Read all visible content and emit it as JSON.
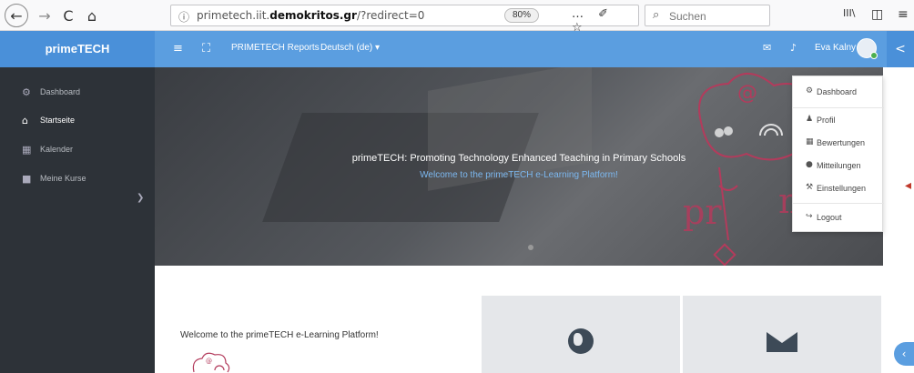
{
  "browser": {
    "back_icon": "←",
    "forward_icon": "→",
    "reload_icon": "C",
    "home_icon": "⌂",
    "url_info_icon": "ⓘ",
    "url_prefix": "primetech.iit.",
    "url_domain": "demokritos.gr",
    "url_suffix": "/?redirect=0",
    "zoom": "80%",
    "url_actions": "… ✐ ☆",
    "search_icon": "⌕",
    "search_placeholder": "Suchen",
    "library_icon": "III\\",
    "sidebar_icon": "◫",
    "menu_icon": "≡"
  },
  "header": {
    "brand": "primeTECH",
    "menu_icon": "≡",
    "fullscreen_icon": "⛶",
    "reports_link": "PRIMETECH Reports",
    "language": "Deutsch (de) ▾",
    "mail_icon": "✉",
    "bell_icon": "♪",
    "user_name": "Eva Kalny",
    "collapse_icon": "<",
    "accent_color": "#5b9ee0"
  },
  "sidebar": {
    "items": [
      {
        "icon": "⚙",
        "label": "Dashboard"
      },
      {
        "icon": "⌂",
        "label": "Startseite"
      },
      {
        "icon": "▦",
        "label": "Kalender"
      },
      {
        "icon": "■",
        "label": "Meine Kurse"
      }
    ],
    "toggle_icon": "❯"
  },
  "hero": {
    "title": "primeTECH: Promoting Technology Enhanced Teaching in Primary Schools",
    "subtitle": "Welcome to the primeTECH e-Learning Platform!"
  },
  "dropdown": {
    "items": [
      {
        "icon": "⚙",
        "label": "Dashboard"
      },
      {
        "icon": "♟",
        "label": "Profil"
      },
      {
        "icon": "▦",
        "label": "Bewertungen"
      },
      {
        "icon": "●",
        "label": "Mitteilungen"
      },
      {
        "icon": "⚒",
        "label": "Einstellungen"
      },
      {
        "icon": "↪",
        "label": "Logout"
      }
    ]
  },
  "content": {
    "welcome": "Welcome to the primeTECH e-Learning Platform!"
  },
  "float_icon": "‹",
  "handle_icon": "◂"
}
